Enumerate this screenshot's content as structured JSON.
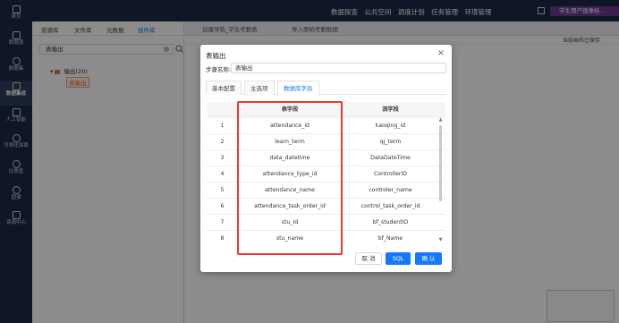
{
  "sidebar": {
    "items": [
      {
        "label": "首页",
        "icon": "home-icon"
      },
      {
        "label": "数据源",
        "icon": "database-icon"
      },
      {
        "label": "数据集",
        "icon": "dataset-icon"
      },
      {
        "label": "数据集成",
        "icon": "integration-icon",
        "active": true
      },
      {
        "label": "人工智能",
        "icon": "ai-icon"
      },
      {
        "label": "可视化探索",
        "icon": "chart-icon"
      },
      {
        "label": "仪表盘",
        "icon": "dashboard-icon"
      },
      {
        "label": "图谱",
        "icon": "graph-icon"
      },
      {
        "label": "资源中心",
        "icon": "resource-icon"
      }
    ]
  },
  "topbar": {
    "links": [
      "数据探查",
      "公共空间",
      "调度计划",
      "任务管理",
      "环境管理"
    ],
    "user_label": "学生用户画像标..."
  },
  "leftpanel": {
    "tabs": [
      "资源库",
      "文件库",
      "元数据",
      "插件库"
    ],
    "search_value": "表输出",
    "tree_root": "输出(20)",
    "tree_child": "表输出"
  },
  "editor": {
    "tabs": [
      "创建导轨_学生考勤表",
      "导入原始考勤数据"
    ],
    "save_status": "当前画布已保存"
  },
  "dialog": {
    "title": "表输出",
    "step_name_label": "步骤名称:",
    "step_name_value": "表输出",
    "tabs": [
      "基本配置",
      "主选项",
      "数据库字段"
    ],
    "active_tab": "数据库字段",
    "table": {
      "headers": [
        "",
        "表字段",
        "流字段"
      ],
      "rows": [
        [
          "1",
          "attendance_id",
          "kaoqing_id"
        ],
        [
          "2",
          "learn_term",
          "qj_term"
        ],
        [
          "3",
          "data_datetime",
          "DataDateTime"
        ],
        [
          "4",
          "attendance_type_id",
          "ControllerID"
        ],
        [
          "5",
          "attendance_name",
          "controler_name"
        ],
        [
          "6",
          "attendance_task_order_id",
          "control_task_order_id"
        ],
        [
          "7",
          "stu_id",
          "bf_studentID"
        ],
        [
          "8",
          "stu_name",
          "bf_Name"
        ]
      ]
    },
    "buttons": {
      "cancel": "取 消",
      "sql": "SQL",
      "ok": "确 认"
    }
  },
  "colors": {
    "sidebar_bg": "#1c2a45",
    "accent": "#1677ff",
    "highlight_box": "#e53935"
  }
}
